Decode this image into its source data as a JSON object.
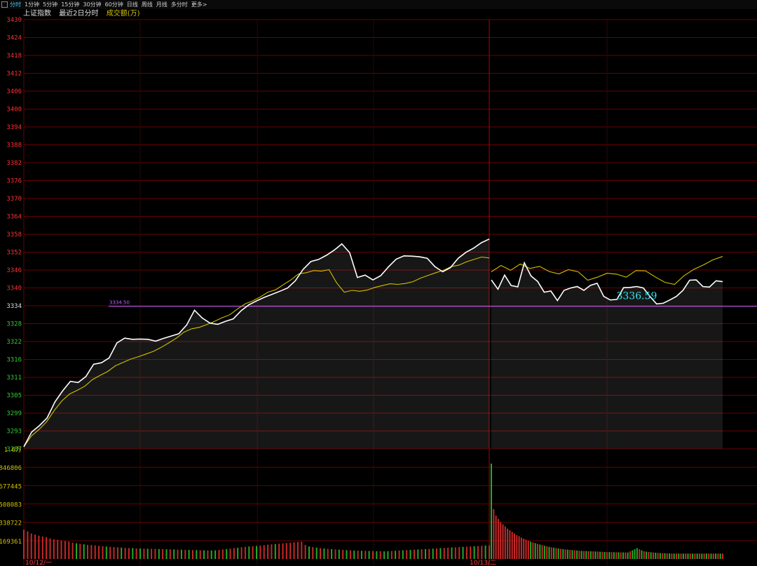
{
  "toolbar": {
    "tabs": [
      "分时",
      "1分钟",
      "5分钟",
      "15分钟",
      "30分钟",
      "60分钟",
      "日线",
      "周线",
      "月线",
      "多分时",
      "更多>"
    ],
    "active": 0
  },
  "header": {
    "index_name": "上证指数",
    "period": "最近2日分时",
    "indicator": "成交额(万)"
  },
  "colors": {
    "up": "#ff3030",
    "down": "#33cc33",
    "price_line": "#ffffff",
    "avg_line": "#d2c000",
    "grid": "#6a0000",
    "ref_line": "#c060ff",
    "annotation": "#2ee6ee",
    "volume_up": "#c82828",
    "volume_down": "#22aa22"
  },
  "chart_data": {
    "type": "line",
    "title": "上证指数 最近2日分时",
    "y_ticks": [
      "3430",
      "3424",
      "3418",
      "3412",
      "3406",
      "3400",
      "3394",
      "3388",
      "3382",
      "3376",
      "3370",
      "3364",
      "3358",
      "3352",
      "3346",
      "3340",
      "3334",
      "3328",
      "3322",
      "3316",
      "3311",
      "3305",
      "3299",
      "3293",
      "3287"
    ],
    "ylim": [
      3287,
      3430
    ],
    "reference_value": 3334.5,
    "reference_label": "3334.50",
    "annotations": [
      {
        "label": "3336.59",
        "day": 2,
        "index": 22
      },
      {
        "label": "3334.50",
        "day": 2,
        "index": 60
      }
    ],
    "x_labels": [
      "10/12/一",
      "10/13/二"
    ],
    "volume_axis": {
      "ticks": [
        "1.6万",
        "846806",
        "677445",
        "508083",
        "338722",
        "169361"
      ],
      "values": [
        1016168,
        846806,
        677445,
        508083,
        338722,
        169361
      ]
    },
    "series": [
      {
        "name": "price",
        "day1": [
          3287.7,
          3292.6,
          3294.7,
          3297.3,
          3302.6,
          3306.3,
          3309.5,
          3309.1,
          3311.1,
          3315.2,
          3315.7,
          3317.3,
          3322.3,
          3323.9,
          3323.5,
          3323.6,
          3323.5,
          3322.9,
          3323.8,
          3324.6,
          3325.4,
          3328.3,
          3333.2,
          3330.6,
          3328.9,
          3328.5,
          3329.5,
          3330.3,
          3333.0,
          3335.0,
          3336.3,
          3337.5,
          3338.5,
          3339.5,
          3340.6,
          3343.0,
          3346.8,
          3349.4,
          3350.1,
          3351.5,
          3353.2,
          3355.3,
          3352.4,
          3344.1,
          3344.9,
          3343.3,
          3344.7,
          3347.6,
          3350.2,
          3351.3,
          3351.2,
          3351.0,
          3350.5,
          3347.7,
          3346.0,
          3347.4,
          3350.5,
          3352.5,
          3353.9,
          3355.7,
          3356.9
        ],
        "day2": [
          3343.3,
          3340.2,
          3344.9,
          3341.4,
          3341.0,
          3349.0,
          3344.6,
          3342.8,
          3339.2,
          3339.6,
          3336.4,
          3339.8,
          3340.6,
          3341.1,
          3339.8,
          3341.5,
          3342.2,
          3337.8,
          3336.6,
          3336.8,
          3340.7,
          3340.8,
          3341.1,
          3340.6,
          3337.8,
          3335.3,
          3335.5,
          3336.6,
          3337.8,
          3339.8,
          3343.2,
          3343.3,
          3341.1,
          3340.9,
          3343.0,
          3342.7
        ]
      },
      {
        "name": "avg",
        "day1": [
          3287.7,
          3291.3,
          3293.5,
          3296.1,
          3299.8,
          3303.0,
          3305.3,
          3306.5,
          3307.9,
          3310.1,
          3311.5,
          3312.8,
          3314.7,
          3315.8,
          3316.9,
          3317.7,
          3318.6,
          3319.5,
          3320.8,
          3322.3,
          3323.9,
          3325.9,
          3327.0,
          3327.5,
          3328.4,
          3329.5,
          3330.7,
          3331.7,
          3333.6,
          3335.3,
          3336.3,
          3337.6,
          3339.2,
          3340.0,
          3341.7,
          3343.3,
          3345.3,
          3345.7,
          3346.4,
          3346.2,
          3346.7,
          3342.3,
          3339.2,
          3339.8,
          3339.5,
          3339.9,
          3340.8,
          3341.4,
          3342.0,
          3341.8,
          3342.1,
          3342.7,
          3343.9,
          3344.8,
          3345.7,
          3346.5,
          3347.7,
          3348.2,
          3349.3,
          3350.1,
          3350.9,
          3350.6
        ],
        "day2": [
          3346.0,
          3348.1,
          3346.5,
          3348.6,
          3347.1,
          3347.8,
          3346.1,
          3345.3,
          3346.7,
          3346.0,
          3343.2,
          3344.2,
          3345.5,
          3345.2,
          3344.2,
          3346.4,
          3346.3,
          3344.3,
          3342.5,
          3341.8,
          3344.7,
          3346.8,
          3348.3,
          3350.0,
          3351.1
        ]
      }
    ],
    "volume": {
      "day1": [
        {
          "v": 270000,
          "up": 1
        },
        {
          "v": 255000,
          "up": 1
        },
        {
          "v": 235000,
          "up": 1
        },
        {
          "v": 225000,
          "up": 1
        },
        {
          "v": 215000,
          "up": 1
        },
        {
          "v": 208000,
          "up": 1
        },
        {
          "v": 200000,
          "up": 1
        },
        {
          "v": 190000,
          "up": 1
        },
        {
          "v": 182000,
          "up": 1
        },
        {
          "v": 176000,
          "up": 1
        },
        {
          "v": 170000,
          "up": 1
        },
        {
          "v": 165000,
          "up": 1
        },
        {
          "v": 160000,
          "up": 1
        },
        {
          "v": 150000,
          "up": 1
        },
        {
          "v": 145000,
          "up": 0
        },
        {
          "v": 140000,
          "up": 1
        },
        {
          "v": 135000,
          "up": 0
        },
        {
          "v": 130000,
          "up": 1
        },
        {
          "v": 128000,
          "up": 1
        },
        {
          "v": 125000,
          "up": 1
        },
        {
          "v": 121000,
          "up": 1
        },
        {
          "v": 118000,
          "up": 1
        },
        {
          "v": 115000,
          "up": 0
        },
        {
          "v": 112000,
          "up": 1
        },
        {
          "v": 110000,
          "up": 1
        },
        {
          "v": 108000,
          "up": 1
        },
        {
          "v": 105000,
          "up": 0
        },
        {
          "v": 103000,
          "up": 1
        },
        {
          "v": 101000,
          "up": 1
        },
        {
          "v": 100000,
          "up": 0
        },
        {
          "v": 98000,
          "up": 1
        },
        {
          "v": 97000,
          "up": 0
        },
        {
          "v": 96000,
          "up": 1
        },
        {
          "v": 95000,
          "up": 0
        },
        {
          "v": 94000,
          "up": 1
        },
        {
          "v": 93000,
          "up": 1
        },
        {
          "v": 92000,
          "up": 0
        },
        {
          "v": 91000,
          "up": 1
        },
        {
          "v": 90000,
          "up": 0
        },
        {
          "v": 89000,
          "up": 1
        },
        {
          "v": 88000,
          "up": 0
        },
        {
          "v": 87000,
          "up": 1
        },
        {
          "v": 86000,
          "up": 0
        },
        {
          "v": 85000,
          "up": 1
        },
        {
          "v": 84000,
          "up": 0
        },
        {
          "v": 83000,
          "up": 1
        },
        {
          "v": 82000,
          "up": 0
        },
        {
          "v": 81000,
          "up": 1
        },
        {
          "v": 80000,
          "up": 0
        },
        {
          "v": 79000,
          "up": 1
        },
        {
          "v": 78000,
          "up": 0
        },
        {
          "v": 80000,
          "up": 0
        },
        {
          "v": 84000,
          "up": 1
        },
        {
          "v": 88000,
          "up": 1
        },
        {
          "v": 92000,
          "up": 0
        },
        {
          "v": 96000,
          "up": 1
        },
        {
          "v": 100000,
          "up": 1
        },
        {
          "v": 104000,
          "up": 0
        },
        {
          "v": 108000,
          "up": 1
        },
        {
          "v": 112000,
          "up": 1
        },
        {
          "v": 115000,
          "up": 0
        },
        {
          "v": 118000,
          "up": 1
        },
        {
          "v": 120000,
          "up": 0
        },
        {
          "v": 124000,
          "up": 1
        },
        {
          "v": 128000,
          "up": 1
        },
        {
          "v": 132000,
          "up": 1
        },
        {
          "v": 135000,
          "up": 1
        },
        {
          "v": 138000,
          "up": 0
        },
        {
          "v": 141000,
          "up": 1
        },
        {
          "v": 144000,
          "up": 1
        },
        {
          "v": 147000,
          "up": 1
        },
        {
          "v": 150000,
          "up": 1
        },
        {
          "v": 154000,
          "up": 1
        },
        {
          "v": 157000,
          "up": 1
        },
        {
          "v": 160000,
          "up": 1
        },
        {
          "v": 130000,
          "up": 1
        },
        {
          "v": 115000,
          "up": 0
        },
        {
          "v": 110000,
          "up": 1
        },
        {
          "v": 105000,
          "up": 0
        },
        {
          "v": 100000,
          "up": 1
        },
        {
          "v": 97000,
          "up": 0
        },
        {
          "v": 94000,
          "up": 1
        },
        {
          "v": 91000,
          "up": 0
        },
        {
          "v": 88000,
          "up": 1
        },
        {
          "v": 86000,
          "up": 0
        },
        {
          "v": 84000,
          "up": 1
        },
        {
          "v": 82000,
          "up": 0
        },
        {
          "v": 80000,
          "up": 1
        },
        {
          "v": 78000,
          "up": 0
        },
        {
          "v": 77000,
          "up": 1
        },
        {
          "v": 76000,
          "up": 0
        },
        {
          "v": 75000,
          "up": 1
        },
        {
          "v": 74000,
          "up": 0
        },
        {
          "v": 73000,
          "up": 1
        },
        {
          "v": 72000,
          "up": 0
        },
        {
          "v": 71000,
          "up": 1
        },
        {
          "v": 70000,
          "up": 0
        },
        {
          "v": 72000,
          "up": 0
        },
        {
          "v": 74000,
          "up": 1
        },
        {
          "v": 76000,
          "up": 0
        },
        {
          "v": 78000,
          "up": 1
        },
        {
          "v": 80000,
          "up": 0
        },
        {
          "v": 82000,
          "up": 1
        },
        {
          "v": 84000,
          "up": 0
        },
        {
          "v": 86000,
          "up": 1
        },
        {
          "v": 88000,
          "up": 0
        },
        {
          "v": 90000,
          "up": 1
        },
        {
          "v": 92000,
          "up": 0
        },
        {
          "v": 94000,
          "up": 1
        },
        {
          "v": 96000,
          "up": 0
        },
        {
          "v": 98000,
          "up": 1
        },
        {
          "v": 100000,
          "up": 0
        },
        {
          "v": 102000,
          "up": 1
        },
        {
          "v": 104000,
          "up": 1
        },
        {
          "v": 106000,
          "up": 0
        },
        {
          "v": 108000,
          "up": 1
        },
        {
          "v": 110000,
          "up": 1
        },
        {
          "v": 112000,
          "up": 0
        },
        {
          "v": 114000,
          "up": 1
        },
        {
          "v": 116000,
          "up": 1
        },
        {
          "v": 118000,
          "up": 0
        },
        {
          "v": 120000,
          "up": 1
        },
        {
          "v": 122000,
          "up": 1
        },
        {
          "v": 124000,
          "up": 0
        },
        {
          "v": 126000,
          "up": 1
        }
      ],
      "day2": [
        {
          "v": 880000,
          "up": 0
        },
        {
          "v": 460000,
          "up": 1
        },
        {
          "v": 400000,
          "up": 1
        },
        {
          "v": 370000,
          "up": 1
        },
        {
          "v": 340000,
          "up": 1
        },
        {
          "v": 320000,
          "up": 1
        },
        {
          "v": 300000,
          "up": 1
        },
        {
          "v": 280000,
          "up": 1
        },
        {
          "v": 265000,
          "up": 1
        },
        {
          "v": 250000,
          "up": 1
        },
        {
          "v": 235000,
          "up": 1
        },
        {
          "v": 220000,
          "up": 1
        },
        {
          "v": 210000,
          "up": 1
        },
        {
          "v": 198000,
          "up": 1
        },
        {
          "v": 188000,
          "up": 1
        },
        {
          "v": 178000,
          "up": 1
        },
        {
          "v": 168000,
          "up": 1
        },
        {
          "v": 160000,
          "up": 0
        },
        {
          "v": 152000,
          "up": 1
        },
        {
          "v": 146000,
          "up": 0
        },
        {
          "v": 140000,
          "up": 1
        },
        {
          "v": 134000,
          "up": 0
        },
        {
          "v": 128000,
          "up": 1
        },
        {
          "v": 122000,
          "up": 0
        },
        {
          "v": 117000,
          "up": 1
        },
        {
          "v": 112000,
          "up": 0
        },
        {
          "v": 108000,
          "up": 1
        },
        {
          "v": 104000,
          "up": 0
        },
        {
          "v": 100000,
          "up": 1
        },
        {
          "v": 97000,
          "up": 0
        },
        {
          "v": 94000,
          "up": 1
        },
        {
          "v": 91000,
          "up": 0
        },
        {
          "v": 88000,
          "up": 1
        },
        {
          "v": 86000,
          "up": 0
        },
        {
          "v": 84000,
          "up": 1
        },
        {
          "v": 82000,
          "up": 0
        },
        {
          "v": 80000,
          "up": 1
        },
        {
          "v": 78000,
          "up": 0
        },
        {
          "v": 76000,
          "up": 1
        },
        {
          "v": 75000,
          "up": 0
        },
        {
          "v": 74000,
          "up": 1
        },
        {
          "v": 73000,
          "up": 0
        },
        {
          "v": 72000,
          "up": 1
        },
        {
          "v": 71000,
          "up": 0
        },
        {
          "v": 70000,
          "up": 1
        },
        {
          "v": 69000,
          "up": 0
        },
        {
          "v": 68000,
          "up": 1
        },
        {
          "v": 67000,
          "up": 0
        },
        {
          "v": 66000,
          "up": 1
        },
        {
          "v": 65000,
          "up": 0
        },
        {
          "v": 64000,
          "up": 1
        },
        {
          "v": 64000,
          "up": 0
        },
        {
          "v": 63000,
          "up": 1
        },
        {
          "v": 63000,
          "up": 0
        },
        {
          "v": 62000,
          "up": 1
        },
        {
          "v": 62000,
          "up": 0
        },
        {
          "v": 61000,
          "up": 1
        },
        {
          "v": 61000,
          "up": 0
        },
        {
          "v": 60000,
          "up": 1
        },
        {
          "v": 60000,
          "up": 0
        },
        {
          "v": 70000,
          "up": 1
        },
        {
          "v": 80000,
          "up": 0
        },
        {
          "v": 90000,
          "up": 0
        },
        {
          "v": 100000,
          "up": 0
        },
        {
          "v": 90000,
          "up": 1
        },
        {
          "v": 80000,
          "up": 0
        },
        {
          "v": 72000,
          "up": 1
        },
        {
          "v": 68000,
          "up": 0
        },
        {
          "v": 65000,
          "up": 1
        },
        {
          "v": 62000,
          "up": 0
        },
        {
          "v": 60000,
          "up": 1
        },
        {
          "v": 58000,
          "up": 0
        },
        {
          "v": 56000,
          "up": 1
        },
        {
          "v": 55000,
          "up": 0
        },
        {
          "v": 54000,
          "up": 1
        },
        {
          "v": 53000,
          "up": 0
        },
        {
          "v": 52000,
          "up": 1
        },
        {
          "v": 51000,
          "up": 0
        },
        {
          "v": 50000,
          "up": 1
        },
        {
          "v": 50000,
          "up": 0
        },
        {
          "v": 50000,
          "up": 1
        },
        {
          "v": 50000,
          "up": 0
        },
        {
          "v": 50000,
          "up": 1
        },
        {
          "v": 50000,
          "up": 0
        },
        {
          "v": 50000,
          "up": 1
        },
        {
          "v": 50000,
          "up": 0
        },
        {
          "v": 50000,
          "up": 1
        },
        {
          "v": 50000,
          "up": 0
        },
        {
          "v": 50000,
          "up": 1
        },
        {
          "v": 50000,
          "up": 0
        },
        {
          "v": 50000,
          "up": 1
        },
        {
          "v": 50000,
          "up": 0
        },
        {
          "v": 50000,
          "up": 1
        },
        {
          "v": 50000,
          "up": 0
        },
        {
          "v": 50000,
          "up": 1
        },
        {
          "v": 50000,
          "up": 0
        },
        {
          "v": 50000,
          "up": 1
        },
        {
          "v": 50000,
          "up": 0
        },
        {
          "v": 50000,
          "up": 1
        },
        {
          "v": 50000,
          "up": 0
        },
        {
          "v": 50000,
          "up": 1
        }
      ]
    }
  }
}
